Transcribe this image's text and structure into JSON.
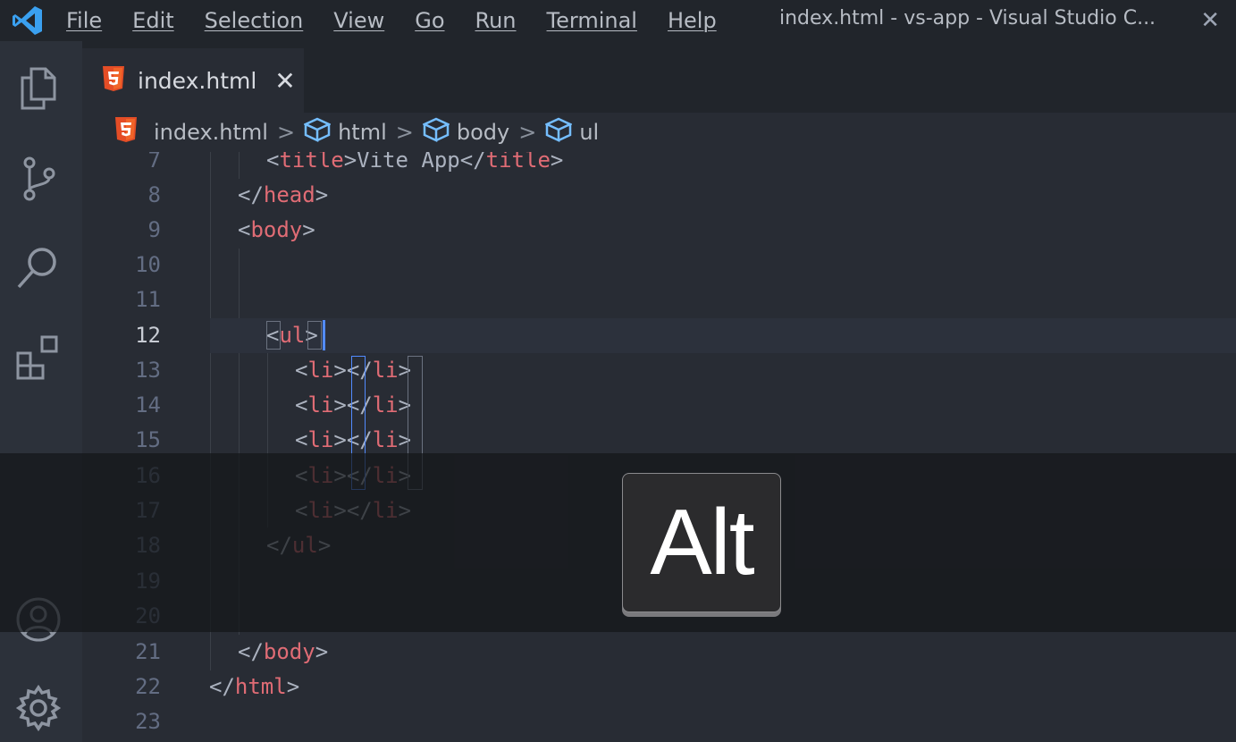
{
  "titlebar": {
    "menu": [
      "File",
      "Edit",
      "Selection",
      "View",
      "Go",
      "Run",
      "Terminal",
      "Help"
    ],
    "window_title": "index.html - vs-app - Visual Studio C...",
    "close_glyph": "✕"
  },
  "tabs": [
    {
      "label": "index.html",
      "close_glyph": "✕",
      "icon": "html5-icon"
    }
  ],
  "breadcrumbs": [
    {
      "label": "index.html",
      "icon": "html5-icon"
    },
    {
      "label": "html",
      "icon": "symbol-cube-icon"
    },
    {
      "label": "body",
      "icon": "symbol-cube-icon"
    },
    {
      "label": "ul",
      "icon": "symbol-cube-icon"
    }
  ],
  "breadcrumb_separator": ">",
  "editor": {
    "current_line": 12,
    "lines": [
      {
        "n": "7"
      },
      {
        "n": "8"
      },
      {
        "n": "9"
      },
      {
        "n": "10"
      },
      {
        "n": "11"
      },
      {
        "n": "12"
      },
      {
        "n": "13"
      },
      {
        "n": "14"
      },
      {
        "n": "15"
      },
      {
        "n": "16"
      },
      {
        "n": "17"
      },
      {
        "n": "18"
      },
      {
        "n": "19"
      },
      {
        "n": "20"
      },
      {
        "n": "21"
      },
      {
        "n": "22"
      },
      {
        "n": "23"
      }
    ],
    "tokens": {
      "lt": "<",
      "gt": ">",
      "lt_slash": "</",
      "title": "title",
      "title_text": "Vite App",
      "head": "head",
      "body": "body",
      "ul": "ul",
      "li": "li",
      "html": "html"
    }
  },
  "key_overlay": {
    "label": "Alt"
  },
  "colors": {
    "accent": "#528bff",
    "tag": "#e06c75",
    "html5": "#e44d26"
  }
}
